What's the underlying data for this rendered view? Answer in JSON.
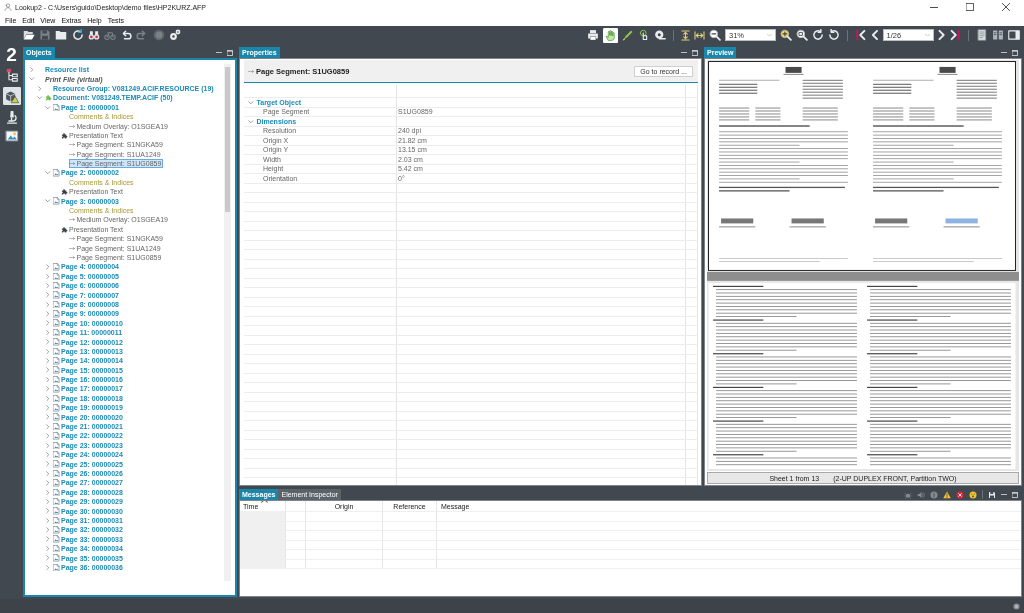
{
  "window": {
    "title": "Lookup2 - C:\\Users\\guido\\Desktop\\demo files\\HP2KURZ.AFP"
  },
  "menu": [
    "File",
    "Edit",
    "View",
    "Extras",
    "Help",
    "Tests"
  ],
  "toolbar": {
    "file_tools": [
      {
        "disabled": false
      },
      {
        "disabled": true
      },
      {
        "disabled": false
      },
      {
        "disabled": false
      },
      {
        "disabled": false
      },
      {
        "disabled": true
      },
      {
        "disabled": false
      },
      {
        "disabled": true
      },
      {
        "disabled": true
      },
      {
        "disabled": false
      }
    ],
    "pointer_tools": [
      {
        "selected": true
      },
      {
        "selected": false
      },
      {
        "selected": false
      }
    ],
    "zoom": "31%",
    "page": "1/26"
  },
  "activity_bar": {
    "logo": "2",
    "items": [
      {
        "selected": false
      },
      {
        "selected": true
      },
      {
        "selected": false
      },
      {
        "selected": false
      }
    ]
  },
  "objects_panel": {
    "tab": "Objects",
    "tree": [
      {
        "label": "Resource list",
        "kind": "group",
        "expanded": false,
        "selected": false
      },
      {
        "label": "Print File (virtual)",
        "kind": "file",
        "expanded": true,
        "selected": false,
        "children": [
          {
            "label": "Resource Group: V081249.ACIF.RESOURCE (19)",
            "kind": "group",
            "expanded": false,
            "selected": false
          },
          {
            "label": "Document: V081249.TEMP.ACIF (50)",
            "kind": "document",
            "expanded": true,
            "selected": false,
            "children": [
              {
                "label": "Page 1: 00000001",
                "kind": "page",
                "expanded": true,
                "selected": false,
                "children": [
                  {
                    "label": "Comments & Indices",
                    "kind": "comments",
                    "selected": false
                  },
                  {
                    "label": "Medium Overlay: O1SGEA19",
                    "kind": "reference",
                    "selected": false
                  },
                  {
                    "label": "Presentation Text",
                    "kind": "text",
                    "selected": false
                  },
                  {
                    "label": "Page Segment: S1NGKA59",
                    "kind": "reference",
                    "selected": false
                  },
                  {
                    "label": "Page Segment: S1UA1249",
                    "kind": "reference",
                    "selected": false
                  },
                  {
                    "label": "Page Segment: S1UG0859",
                    "kind": "reference",
                    "selected": true
                  }
                ]
              },
              {
                "label": "Page 2: 00000002",
                "kind": "page",
                "expanded": true,
                "selected": false,
                "children": [
                  {
                    "label": "Comments & Indices",
                    "kind": "comments",
                    "selected": false
                  },
                  {
                    "label": "Presentation Text",
                    "kind": "text",
                    "selected": false
                  }
                ]
              },
              {
                "label": "Page 3: 00000003",
                "kind": "page",
                "expanded": true,
                "selected": false,
                "children": [
                  {
                    "label": "Comments & Indices",
                    "kind": "comments",
                    "selected": false
                  },
                  {
                    "label": "Medium Overlay: O1SGEA19",
                    "kind": "reference",
                    "selected": false
                  },
                  {
                    "label": "Presentation Text",
                    "kind": "text",
                    "selected": false
                  },
                  {
                    "label": "Page Segment: S1NGKA59",
                    "kind": "reference",
                    "selected": false
                  },
                  {
                    "label": "Page Segment: S1UA1249",
                    "kind": "reference",
                    "selected": false
                  },
                  {
                    "label": "Page Segment: S1UG0859",
                    "kind": "reference",
                    "selected": false
                  }
                ]
              },
              {
                "label": "Page 4: 00000004",
                "kind": "page",
                "expanded": false,
                "selected": false
              },
              {
                "label": "Page 5: 00000005",
                "kind": "page",
                "expanded": false,
                "selected": false
              },
              {
                "label": "Page 6: 00000006",
                "kind": "page",
                "expanded": false,
                "selected": false
              },
              {
                "label": "Page 7: 00000007",
                "kind": "page",
                "expanded": false,
                "selected": false
              },
              {
                "label": "Page 8: 00000008",
                "kind": "page",
                "expanded": false,
                "selected": false
              },
              {
                "label": "Page 9: 00000009",
                "kind": "page",
                "expanded": false,
                "selected": false
              },
              {
                "label": "Page 10: 00000010",
                "kind": "page",
                "expanded": false,
                "selected": false
              },
              {
                "label": "Page 11: 00000011",
                "kind": "page",
                "expanded": false,
                "selected": false
              },
              {
                "label": "Page 12: 00000012",
                "kind": "page",
                "expanded": false,
                "selected": false
              },
              {
                "label": "Page 13: 00000013",
                "kind": "page",
                "expanded": false,
                "selected": false
              },
              {
                "label": "Page 14: 00000014",
                "kind": "page",
                "expanded": false,
                "selected": false
              },
              {
                "label": "Page 15: 00000015",
                "kind": "page",
                "expanded": false,
                "selected": false
              },
              {
                "label": "Page 16: 00000016",
                "kind": "page",
                "expanded": false,
                "selected": false
              },
              {
                "label": "Page 17: 00000017",
                "kind": "page",
                "expanded": false,
                "selected": false
              },
              {
                "label": "Page 18: 00000018",
                "kind": "page",
                "expanded": false,
                "selected": false
              },
              {
                "label": "Page 19: 00000019",
                "kind": "page",
                "expanded": false,
                "selected": false
              },
              {
                "label": "Page 20: 00000020",
                "kind": "page",
                "expanded": false,
                "selected": false
              },
              {
                "label": "Page 21: 00000021",
                "kind": "page",
                "expanded": false,
                "selected": false
              },
              {
                "label": "Page 22: 00000022",
                "kind": "page",
                "expanded": false,
                "selected": false
              },
              {
                "label": "Page 23: 00000023",
                "kind": "page",
                "expanded": false,
                "selected": false
              },
              {
                "label": "Page 24: 00000024",
                "kind": "page",
                "expanded": false,
                "selected": false
              },
              {
                "label": "Page 25: 00000025",
                "kind": "page",
                "expanded": false,
                "selected": false
              },
              {
                "label": "Page 26: 00000026",
                "kind": "page",
                "expanded": false,
                "selected": false
              },
              {
                "label": "Page 27: 00000027",
                "kind": "page",
                "expanded": false,
                "selected": false
              },
              {
                "label": "Page 28: 00000028",
                "kind": "page",
                "expanded": false,
                "selected": false
              },
              {
                "label": "Page 29: 00000029",
                "kind": "page",
                "expanded": false,
                "selected": false
              },
              {
                "label": "Page 30: 00000030",
                "kind": "page",
                "expanded": false,
                "selected": false
              },
              {
                "label": "Page 31: 00000031",
                "kind": "page",
                "expanded": false,
                "selected": false
              },
              {
                "label": "Page 32: 00000032",
                "kind": "page",
                "expanded": false,
                "selected": false
              },
              {
                "label": "Page 33: 00000033",
                "kind": "page",
                "expanded": false,
                "selected": false
              },
              {
                "label": "Page 34: 00000034",
                "kind": "page",
                "expanded": false,
                "selected": false
              },
              {
                "label": "Page 35: 00000035",
                "kind": "page",
                "expanded": false,
                "selected": false
              },
              {
                "label": "Page 36: 00000036",
                "kind": "page",
                "expanded": false,
                "selected": false
              }
            ]
          }
        ]
      }
    ]
  },
  "properties_panel": {
    "tab": "Properties",
    "heading": "Page Segment: S1UG0859",
    "button": "Go to record ...",
    "groups": [
      {
        "label": "Target Object",
        "expanded": true,
        "rows": [
          {
            "name": "Page Segment",
            "value": "S1UG0859"
          }
        ]
      },
      {
        "label": "Dimensions",
        "expanded": true,
        "rows": [
          {
            "name": "Resolution",
            "value": "240 dpi"
          },
          {
            "name": "Origin X",
            "value": "21.82 cm"
          },
          {
            "name": "Origin Y",
            "value": "13.15 cm"
          },
          {
            "name": "Width",
            "value": "2.03 cm"
          },
          {
            "name": "Height",
            "value": "5.42 cm"
          },
          {
            "name": "Orientation",
            "value": "0°"
          }
        ]
      }
    ]
  },
  "preview_panel": {
    "tab": "Preview",
    "sheet": "Sheet 1 from 13",
    "layout": "(2-UP DUPLEX FRONT, Partition TWO)"
  },
  "messages_panel": {
    "tabs": [
      {
        "label": "Messages",
        "selected": true
      },
      {
        "label": "Element Inspector",
        "selected": false
      }
    ],
    "filters": [
      {
        "on": false
      },
      {
        "on": false
      },
      {
        "on": false
      },
      {
        "on": true
      },
      {
        "on": true
      },
      {
        "on": true
      }
    ],
    "columns": [
      {
        "label": "Time",
        "sorted": true
      },
      {
        "label": "Origin",
        "sorted": false
      },
      {
        "label": "Reference",
        "sorted": false
      },
      {
        "label": "Message",
        "sorted": false
      }
    ]
  }
}
